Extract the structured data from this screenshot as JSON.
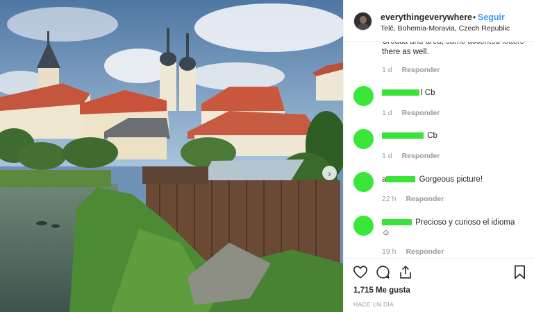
{
  "post": {
    "username": "everythingeverywhere",
    "separator": "•",
    "follow_label": "Seguir",
    "location": "Telč, Bohemia-Moravia, Czech Republic",
    "next_glyph": "›"
  },
  "comments": {
    "partial_text": "Croatia and area, same accented letters there as well.",
    "items": [
      {
        "time": "1 d",
        "reply": "Responder"
      },
      {
        "user_suffix": "l",
        "text": "Cb",
        "time": "1 d",
        "reply": "Responder"
      },
      {
        "user_suffix": "",
        "text": "Cb",
        "time": "1 d",
        "reply": "Responder"
      },
      {
        "user_prefix": "a",
        "text": "Gorgeous picture!",
        "time": "22 h",
        "reply": "Responder"
      },
      {
        "text": "Precioso y curioso el idioma",
        "emoji": "☺",
        "time": "19 h",
        "reply": "Responder"
      }
    ]
  },
  "actions": {
    "likes": "1,715 Me gusta",
    "time_ago": "HACE UN DÍA"
  },
  "icons": {
    "like": "heart-icon",
    "comment": "comment-icon",
    "share": "share-icon",
    "save": "bookmark-icon"
  },
  "colors": {
    "follow": "#3897f0",
    "redaction": "#39e639"
  }
}
